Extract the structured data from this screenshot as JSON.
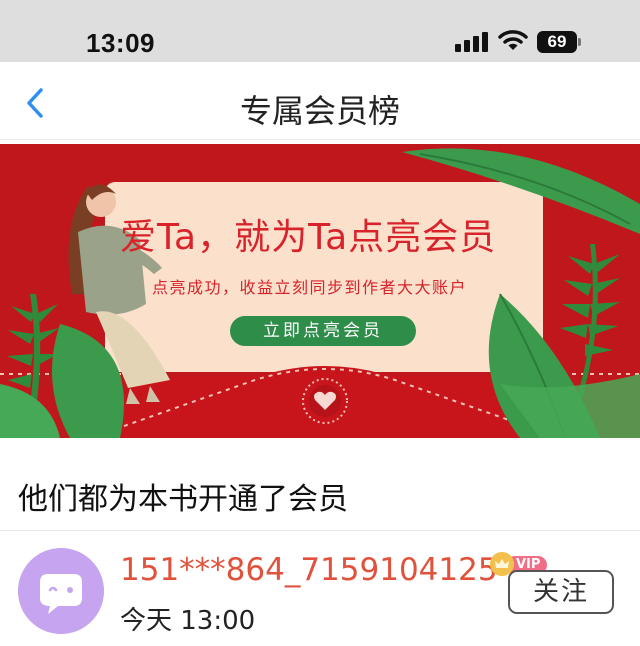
{
  "status_bar": {
    "time": "13:09",
    "battery": "69",
    "icons": [
      "signal-icon",
      "wifi-icon",
      "battery-icon"
    ]
  },
  "nav": {
    "title": "专属会员榜",
    "back_icon": "chevron-left-icon",
    "accent_color": "#2e8ff0"
  },
  "banner": {
    "title": "爱Ta，就为Ta点亮会员",
    "subtitle": "点亮成功，收益立刻同步到作者大大账户",
    "button_label": "立即点亮会员",
    "background_color": "#c0171c",
    "card_color": "#fbe0cc",
    "button_color": "#2f8d4a"
  },
  "section": {
    "title": "他们都为本书开通了会员"
  },
  "members": [
    {
      "name": "151***864_7159104125",
      "time": "今天 13:00",
      "badge": "VIP",
      "follow_label": "关注",
      "name_color": "#e0523c",
      "avatar_color": "#c7a4f0"
    }
  ]
}
